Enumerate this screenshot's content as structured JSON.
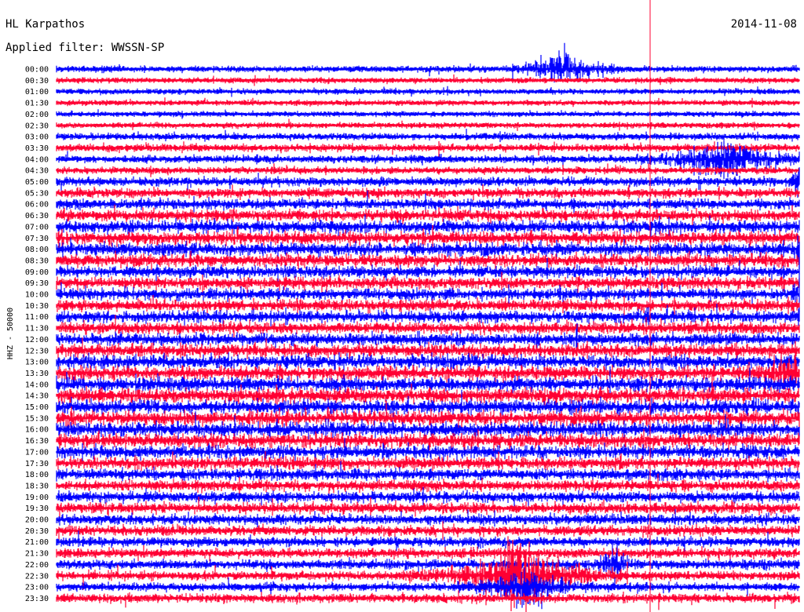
{
  "header": {
    "station": "HL Karpathos",
    "date": "2014-11-08",
    "filter": "Applied filter: WWSSN-SP"
  },
  "chart_data": {
    "type": "helicorder",
    "ylabel": "HHZ - 50000",
    "row_labels": [
      "00:00",
      "00:30",
      "01:00",
      "01:30",
      "02:00",
      "02:30",
      "03:00",
      "03:30",
      "04:00",
      "04:30",
      "05:00",
      "05:30",
      "06:00",
      "06:30",
      "07:00",
      "07:30",
      "08:00",
      "08:30",
      "09:00",
      "09:30",
      "10:00",
      "10:30",
      "11:00",
      "11:30",
      "12:00",
      "12:30",
      "13:00",
      "13:30",
      "14:00",
      "14:30",
      "15:00",
      "15:30",
      "16:00",
      "16:30",
      "17:00",
      "17:30",
      "18:00",
      "18:30",
      "19:00",
      "19:30",
      "20:00",
      "20:30",
      "21:00",
      "21:30",
      "22:00",
      "22:30",
      "23:00",
      "23:30"
    ],
    "trace_colors": [
      "#0000ff",
      "#ff0033"
    ],
    "marker_color": "#ff0033",
    "row_noise_level": [
      0.35,
      0.3,
      0.3,
      0.3,
      0.28,
      0.3,
      0.4,
      0.45,
      0.45,
      0.4,
      0.55,
      0.6,
      0.65,
      0.75,
      0.8,
      0.85,
      0.85,
      0.8,
      0.75,
      0.75,
      0.75,
      0.75,
      0.75,
      0.75,
      0.8,
      0.85,
      0.9,
      0.9,
      0.95,
      0.95,
      0.95,
      0.95,
      0.95,
      0.9,
      0.85,
      0.8,
      0.75,
      0.7,
      0.7,
      0.7,
      0.65,
      0.65,
      0.6,
      0.6,
      0.6,
      0.55,
      0.5,
      0.55
    ],
    "events": [
      {
        "row": 0,
        "minute": 20.5,
        "amplitude": 3.0,
        "width": 0.8
      },
      {
        "row": 8,
        "minute": 27.0,
        "amplitude": 3.2,
        "width": 1.2
      },
      {
        "row": 10,
        "minute": 30.0,
        "amplitude": 4.0,
        "width": 0.1
      },
      {
        "row": 16,
        "minute": 30.0,
        "amplitude": 3.0,
        "width": 0.1
      },
      {
        "row": 20,
        "minute": 30.0,
        "amplitude": 3.0,
        "width": 0.1
      },
      {
        "row": 22,
        "minute": 30.0,
        "amplitude": 3.0,
        "width": 0.1
      },
      {
        "row": 27,
        "minute": 30.0,
        "amplitude": 4.0,
        "width": 0.8
      },
      {
        "row": 44,
        "minute": 22.5,
        "amplitude": 3.0,
        "width": 0.3
      },
      {
        "row": 45,
        "minute": 18.5,
        "amplitude": 5.0,
        "width": 1.5
      },
      {
        "row": 46,
        "minute": 19.0,
        "amplitude": 3.0,
        "width": 1.0
      }
    ]
  }
}
